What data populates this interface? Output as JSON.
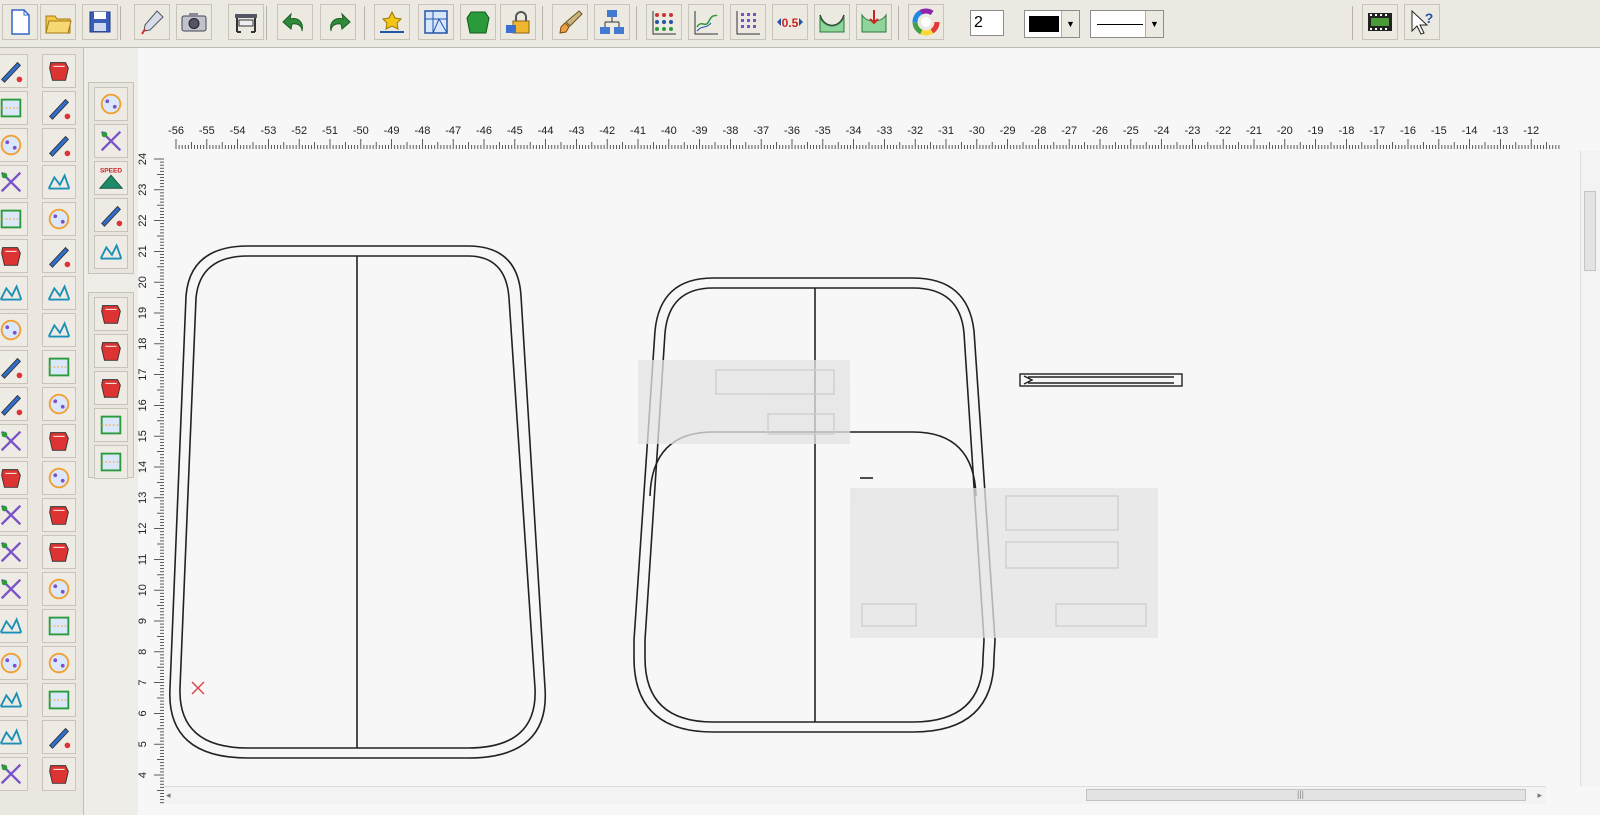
{
  "toolbar": {
    "line_width_value": "2",
    "pen_color": "#000000",
    "buttons": [
      {
        "name": "new-file-icon"
      },
      {
        "name": "open-folder-icon"
      },
      {
        "name": "save-disk-icon"
      },
      {
        "name": "pen-tool-icon"
      },
      {
        "name": "camera-icon"
      },
      {
        "name": "plotter-icon"
      },
      {
        "name": "undo-arrow-icon"
      },
      {
        "name": "redo-arrow-icon"
      },
      {
        "name": "star-measure-icon"
      },
      {
        "name": "grid-window-icon"
      },
      {
        "name": "green-piece-icon"
      },
      {
        "name": "lock-layers-icon"
      },
      {
        "name": "brush-icon"
      },
      {
        "name": "network-icon"
      },
      {
        "name": "dot-grid-icon"
      },
      {
        "name": "curve-chart-icon"
      },
      {
        "name": "grid-table-icon"
      },
      {
        "name": "scale-0-5-icon",
        "label": "0.5"
      },
      {
        "name": "arc-green-icon"
      },
      {
        "name": "arc-red-icon"
      },
      {
        "name": "color-wheel-icon"
      },
      {
        "name": "film-strip-icon"
      },
      {
        "name": "help-cursor-icon"
      }
    ]
  },
  "left_tools": {
    "col1": [
      "select-arrow-icon",
      "pencil-icon",
      "rectangle-icon",
      "dotted-line-icon",
      "intersect-icon",
      "chain-link-icon",
      "compass-icon",
      "cross-cut-icon",
      "ruler-pencil-icon",
      "tag-icon",
      "blue-piece-icon",
      "fold-piece-icon",
      "split-piece-icon",
      "spiral-icon",
      "plus-minus-icon",
      "triangle-icon",
      "scissors-icon",
      "stitch-line-icon",
      "ladder-icon",
      "text-icon"
    ],
    "col2": [
      "select-box-icon",
      "pocket-icon",
      "dashed-piece-icon",
      "sleeve-icon",
      "shift-piece-icon",
      "measure-icon",
      "button-icon",
      "grid-mesh-icon",
      "pie-cut-icon",
      "sewing-machine-icon",
      "notch-icon",
      "rotate-arrow-icon",
      "mirror-piece-icon",
      "pleat-icon",
      "quad-icon",
      "jar-icon",
      "dart-icon",
      "paint-piece-icon",
      "hand-cursor-icon",
      "gradient-icon"
    ]
  },
  "sub_tools": {
    "speed_label": "SPEED",
    "group1": [
      "seam-allowance-icon",
      "cut-line-icon",
      "speed-icon",
      "zigzag-icon",
      "delete-piece-icon"
    ],
    "group2": [
      "trapezoid-icon",
      "cylinder-icon",
      "double-rect-icon",
      "dashed-square-icon",
      "zigzag-film-icon"
    ]
  },
  "ruler": {
    "top_labels": [
      "-56",
      "-55",
      "-54",
      "-53",
      "-52",
      "-51",
      "-50",
      "-49",
      "-48",
      "-47",
      "-46",
      "-45",
      "-44",
      "-43",
      "-42",
      "-41",
      "-40",
      "-39",
      "-38",
      "-37",
      "-36",
      "-35",
      "-34",
      "-33",
      "-32",
      "-31",
      "-30",
      "-29",
      "-28",
      "-27",
      "-26",
      "-25",
      "-24",
      "-23",
      "-22",
      "-21",
      "-20",
      "-19",
      "-18",
      "-17",
      "-16",
      "-15",
      "-14",
      "-13",
      "-12"
    ],
    "left_labels": [
      "24",
      "23",
      "22",
      "21",
      "20",
      "19",
      "18",
      "17",
      "16",
      "15",
      "14",
      "13",
      "12",
      "11",
      "10",
      "9",
      "8",
      "7",
      "6",
      "5",
      "4"
    ]
  }
}
